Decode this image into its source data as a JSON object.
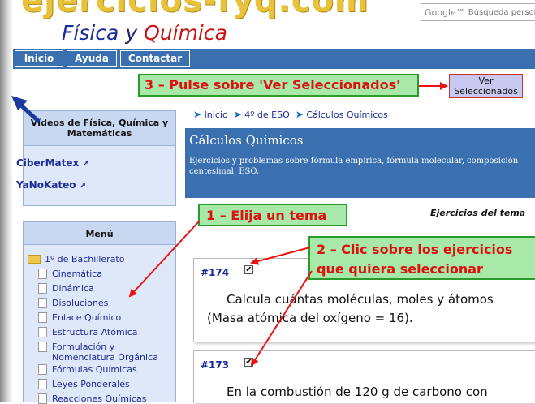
{
  "header": {
    "logo_url_text": "ejercicios-fyq.com",
    "logo_sub": {
      "w1": "Física",
      "w2": "y",
      "w3": "Química"
    },
    "search": {
      "brand": "Google™",
      "placeholder": "Búsqueda personalizada"
    }
  },
  "nav": {
    "items": [
      {
        "label": "Inicio"
      },
      {
        "label": "Ayuda"
      },
      {
        "label": "Contactar"
      }
    ]
  },
  "callouts": {
    "step3": "3 – Pulse sobre 'Ver Seleccionados'",
    "step1": "1 – Elija un tema",
    "step2_line1": "2 – Clic sobre los ejercicios",
    "step2_line2": "que quiera seleccionar"
  },
  "ver_button": {
    "line1": "Ver",
    "line2": "Seleccionados"
  },
  "videos": {
    "title": "Vídeos de Física, Química y Matemáticas",
    "links": [
      {
        "label": "CiberMatex"
      },
      {
        "label": "YaNoKateo"
      }
    ]
  },
  "menu": {
    "title": "Menú",
    "folder": "1º de Bachillerato",
    "items": [
      {
        "label": "Cinemática"
      },
      {
        "label": "Dinámica"
      },
      {
        "label": "Disoluciones"
      },
      {
        "label": "Enlace Químico"
      },
      {
        "label": "Estructura Atómica"
      },
      {
        "label": "Formulación y Nomenclatura Orgánica"
      },
      {
        "label": "Fórmulas Químicas"
      },
      {
        "label": "Leyes Ponderales"
      },
      {
        "label": "Reacciones Químicas"
      }
    ]
  },
  "breadcrumb": {
    "items": [
      {
        "label": "Inicio"
      },
      {
        "label": "4º de ESO"
      },
      {
        "label": "Cálculos Químicos"
      }
    ]
  },
  "section": {
    "title": "Cálculos Químicos",
    "description": "Ejercicios y problemas sobre fórmula empírica, fórmula molecular, composición centesimal, ESO."
  },
  "exercises_title": "Ejercicios del tema",
  "exercises": [
    {
      "id": "#174",
      "line1": "Calcula cuántas moléculas, moles y átomos",
      "line2": "(Masa atómica del oxígeno = 16)."
    },
    {
      "id": "#173",
      "line1": "En la combustión de 120 g de carbono con"
    }
  ],
  "colors": {
    "nav_blue": "#3a70b0",
    "callout_bg": "#a8e8a8",
    "callout_text": "#dd1111",
    "arrow_red": "#ee1111"
  }
}
